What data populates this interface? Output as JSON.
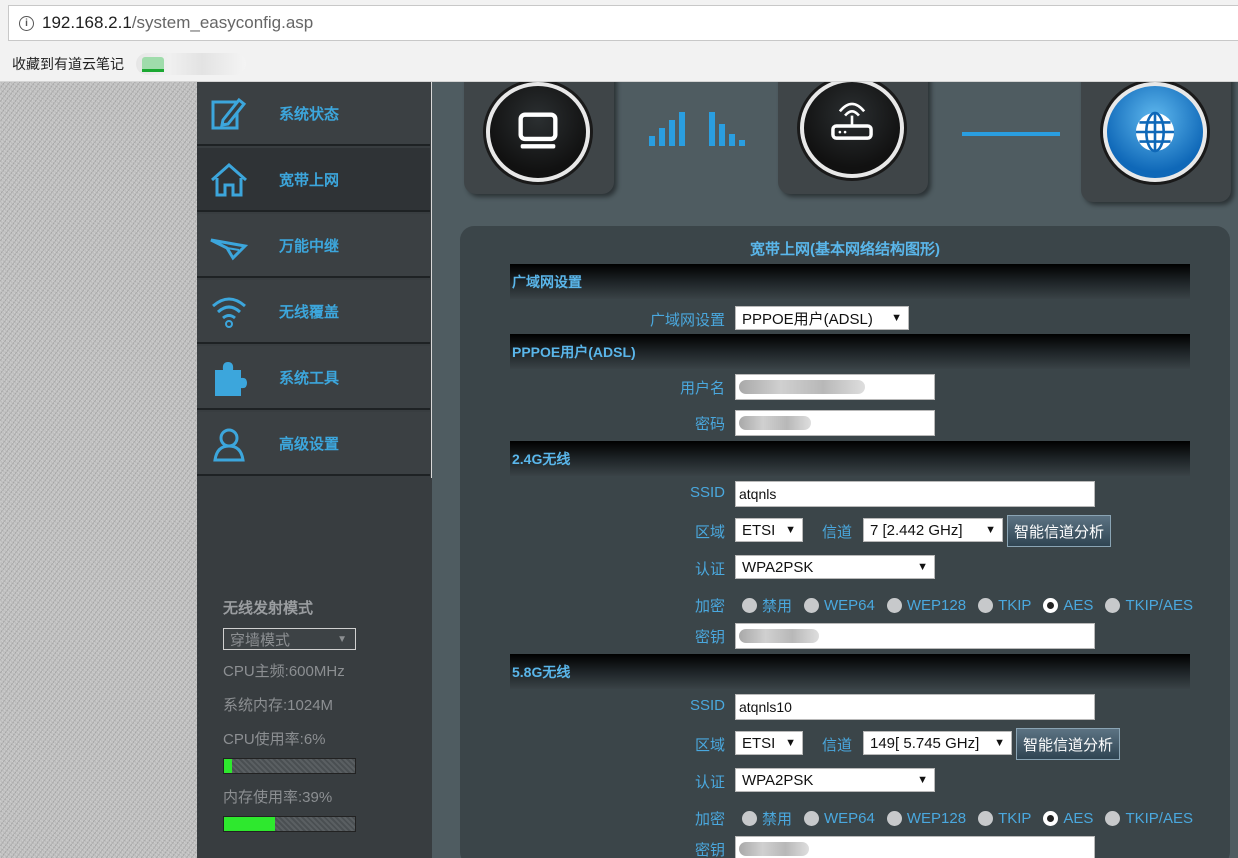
{
  "browser": {
    "url_host": "192.168.2.1",
    "url_path": "/system_easyconfig.asp",
    "bookmark_label": "收藏到有道云笔记"
  },
  "sidebar": {
    "items": [
      {
        "label": "系统状态",
        "icon": "edit-icon"
      },
      {
        "label": "宽带上网",
        "icon": "home-icon"
      },
      {
        "label": "万能中继",
        "icon": "plane-icon"
      },
      {
        "label": "无线覆盖",
        "icon": "wifi-icon"
      },
      {
        "label": "系统工具",
        "icon": "puzzle-icon"
      },
      {
        "label": "高级设置",
        "icon": "user-icon"
      }
    ],
    "mode_title": "无线发射模式",
    "mode_value": "穿墙模式",
    "cpu_freq": "CPU主频:600MHz",
    "memory": "系统内存:1024M",
    "cpu_usage": "CPU使用率:6%",
    "cpu_usage_fraction": 0.06,
    "mem_usage": "内存使用率:39%",
    "mem_usage_fraction": 0.39
  },
  "main": {
    "title": "宽带上网(基本网络结构图形)",
    "wan": {
      "header": "广域网设置",
      "label": "广域网设置",
      "value": "PPPOE用户(ADSL)"
    },
    "pppoe": {
      "header": "PPPOE用户(ADSL)",
      "user_label": "用户名",
      "pass_label": "密码"
    },
    "w24": {
      "header": "2.4G无线",
      "ssid_label": "SSID",
      "ssid": "atqnls",
      "region_label": "区域",
      "region": "ETSI",
      "channel_label": "信道",
      "channel": "7 [2.442 GHz]",
      "analyze": "智能信道分析",
      "auth_label": "认证",
      "auth": "WPA2PSK",
      "enc_label": "加密",
      "enc_options": [
        "禁用",
        "WEP64",
        "WEP128",
        "TKIP",
        "AES",
        "TKIP/AES"
      ],
      "enc_selected": "AES",
      "key_label": "密钥"
    },
    "w58": {
      "header": "5.8G无线",
      "ssid_label": "SSID",
      "ssid": "atqnls10",
      "region_label": "区域",
      "region": "ETSI",
      "channel_label": "信道",
      "channel": "149[ 5.745 GHz]",
      "analyze": "智能信道分析",
      "auth_label": "认证",
      "auth": "WPA2PSK",
      "enc_label": "加密",
      "enc_options": [
        "禁用",
        "WEP64",
        "WEP128",
        "TKIP",
        "AES",
        "TKIP/AES"
      ],
      "enc_selected": "AES",
      "key_label": "密钥"
    }
  },
  "colors": {
    "accent": "#3ca6dc",
    "progress": "#2ee82e"
  }
}
